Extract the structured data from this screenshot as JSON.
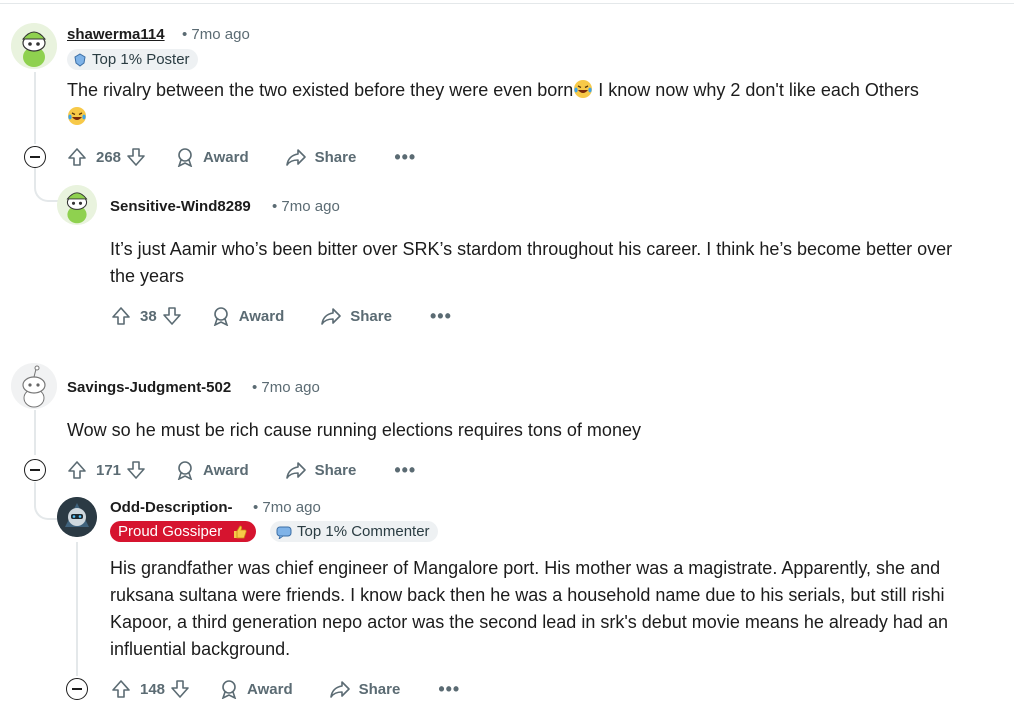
{
  "comments": [
    {
      "username": "shawerma114",
      "time": "• 7mo ago",
      "badge": "Top 1% Poster",
      "body_line1": "The rivalry between the two existed before they were even born",
      "body_line1_tail": " I know now why 2 don't like each Others",
      "votes": "268",
      "award": "Award",
      "share": "Share",
      "more": "•••",
      "avatar_color": "#8fd14f"
    },
    {
      "username": "Sensitive-Wind8289",
      "time": "• 7mo ago",
      "body": "It’s just Aamir who’s been bitter over SRK’s stardom throughout his career. I think he’s become better over the years",
      "votes": "38",
      "award": "Award",
      "share": "Share",
      "more": "•••",
      "avatar_color": "#8fd14f"
    },
    {
      "username": "Savings-Judgment-502",
      "time": "• 7mo ago",
      "body": "Wow so he must be rich cause running elections requires tons of money",
      "votes": "171",
      "award": "Award",
      "share": "Share",
      "more": "•••",
      "avatar_color": "#d7dadc"
    },
    {
      "username": "Odd-Description-",
      "time": "• 7mo ago",
      "badge_flair": "Proud Gossiper",
      "badge": "Top 1% Commenter",
      "body": "His grandfather was chief engineer of Mangalore port. His mother was a magistrate. Apparently, she and ruksana sultana were friends. I know back then he was a household name due to his serials, but still rishi Kapoor, a third generation nepo actor was the second lead in srk's debut movie means he already had an influential background.",
      "votes": "148",
      "award": "Award",
      "share": "Share",
      "more": "•••",
      "avatar_color": "#2b3a44"
    }
  ],
  "colors": {
    "meta": "#5b6b73",
    "thread": "#e4e8ea",
    "flair_red": "#d6142f",
    "badge_bg": "#eef1f3"
  }
}
